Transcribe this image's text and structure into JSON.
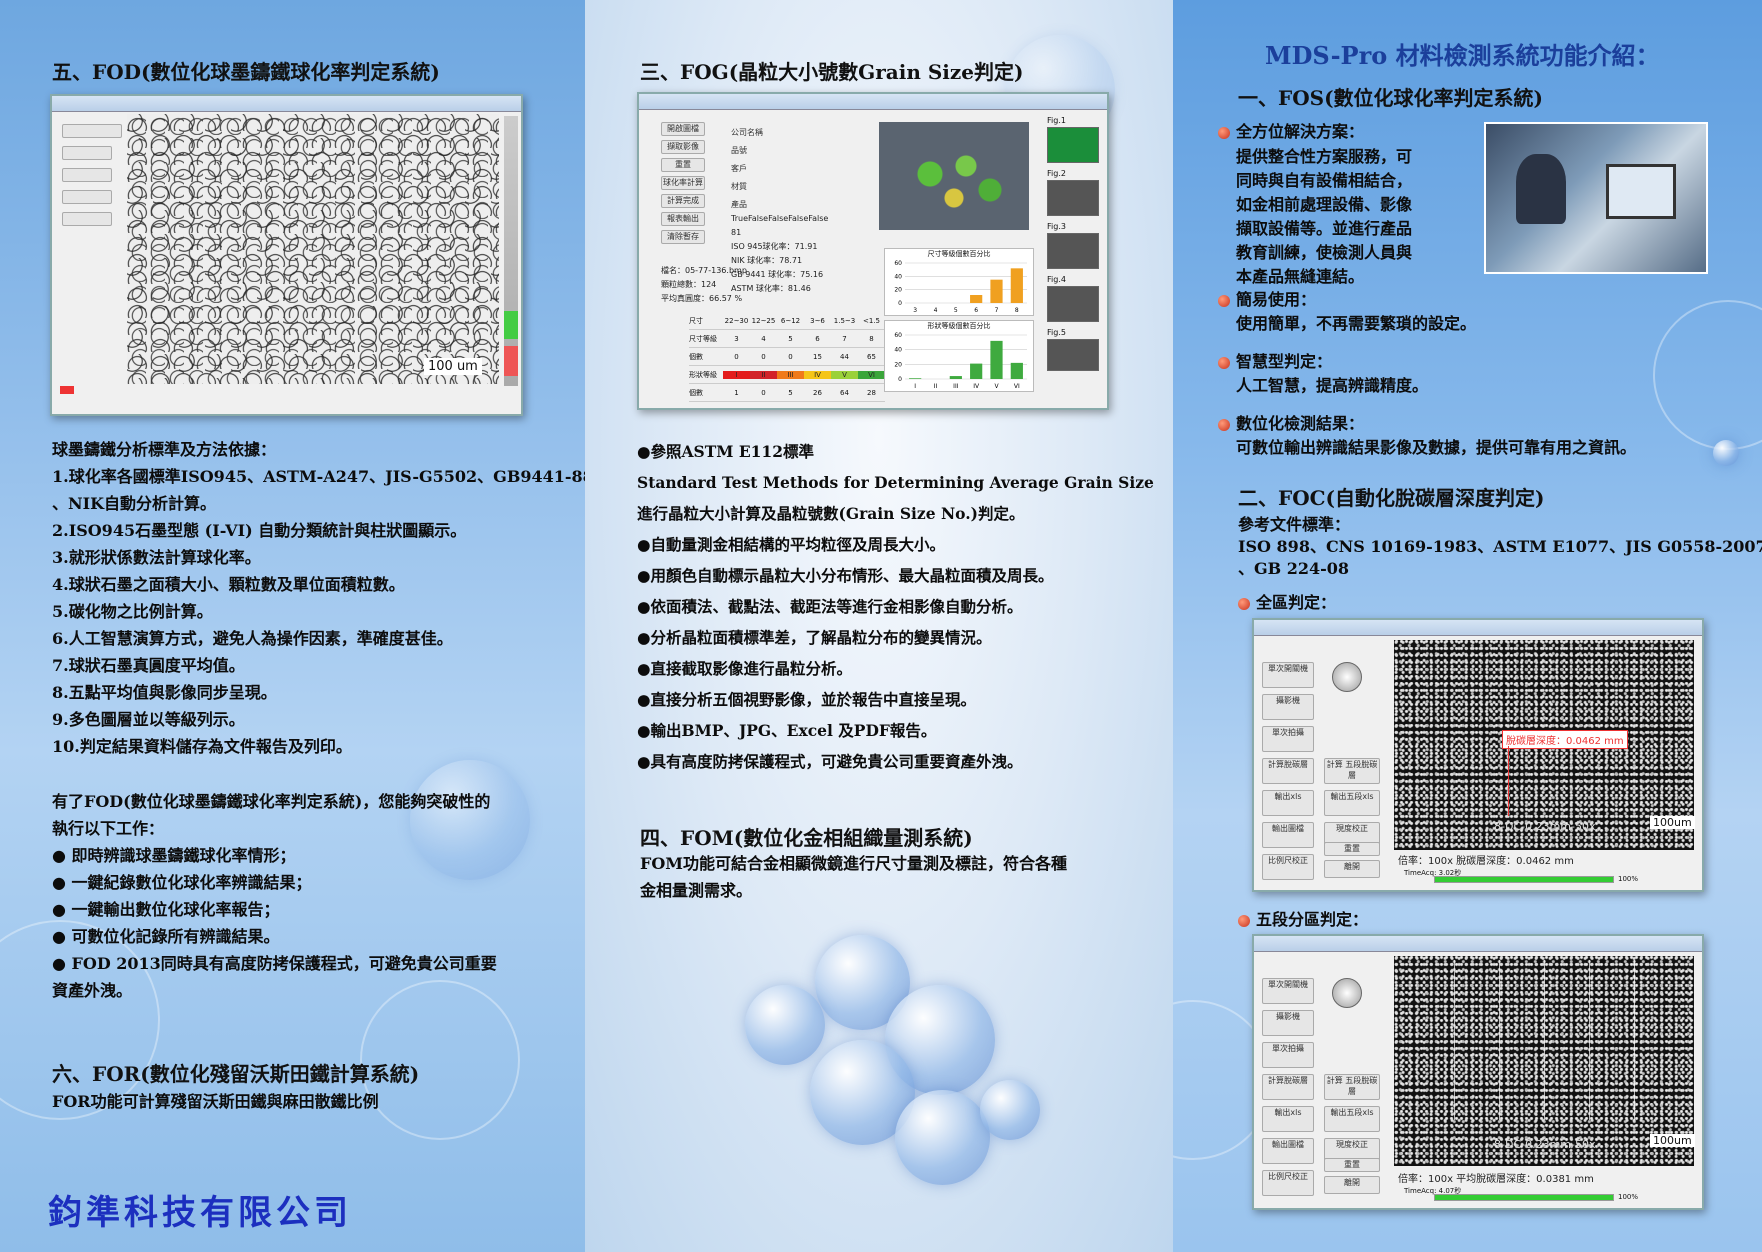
{
  "company": "鈞準科技有限公司",
  "main_title": "MDS-Pro 材料檢測系統功能介紹：",
  "fod": {
    "heading": "五、FOD(數位化球墨鑄鐵球化率判定系統)",
    "scale_label": "100 um",
    "basis_title": "球墨鑄鐵分析標準及方法依據：",
    "basis_items": [
      "1.球化率各國標準ISO945、ASTM-A247、JIS-G5502、GB9441-88",
      "   、NIK自動分析計算。",
      "2.ISO945石墨型態 (I-VI) 自動分類統計與柱狀圖顯示。",
      "3.就形狀係數法計算球化率。",
      "4.球狀石墨之面積大小、顆粒數及單位面積粒數。",
      "5.碳化物之比例計算。",
      "6.人工智慧演算方式，避免人為操作因素，準確度甚佳。",
      "7.球狀石墨真圓度平均值。",
      "8.五點平均值與影像同步呈現。",
      "9.多色圖層並以等級列示。",
      "10.判定結果資料儲存為文件報告及列印。"
    ],
    "work_title_1": "有了FOD(數位化球墨鑄鐵球化率判定系統)，您能夠突破性的",
    "work_title_2": "執行以下工作：",
    "work_items": [
      "●  即時辨識球墨鑄鐵球化率情形；",
      "●  一鍵紀錄數位化球化率辨識結果；",
      "●  一鍵輸出數位化球化率報告；",
      "●  可數位化記錄所有辨識結果。",
      "●  FOD 2013同時具有高度防拷保護程式，可避免貴公司重要",
      "     資產外洩。"
    ]
  },
  "for": {
    "heading": "六、FOR(數位化殘留沃斯田鐵計算系統)",
    "desc": "FOR功能可計算殘留沃斯田鐵與麻田散鐵比例"
  },
  "fog": {
    "heading": "三、FOG(晶粒大小號數Grain Size判定)",
    "screenshot": {
      "readouts": [
        "TrueFalseFalseFalseFalse",
        "81",
        "ISO 945球化率：71.91",
        "NIK 球化率：78.71",
        "GB 9441 球化率：75.16",
        "ASTM 球化率：81.46"
      ],
      "file_info": [
        "檔名：05-77-136.bmp",
        "顆粒總數：124",
        "平均真圓度：66.57 %"
      ],
      "chart1_title": "尺寸等級個數百分比",
      "chart2_title": "形狀等級個數百分比",
      "fig_labels": [
        "Fig.1",
        "Fig.2",
        "Fig.3",
        "Fig.4",
        "Fig.5"
      ],
      "buttons": [
        "開啟圖檔",
        "擷取影像",
        "重置",
        "球化率計算",
        "計算完成",
        "報表輸出",
        "清除暫存"
      ],
      "fields": [
        "公司名稱",
        "品號",
        "客戶",
        "材質",
        "產品"
      ],
      "table_rows": [
        {
          "label": "尺寸",
          "cells": [
            "22~30",
            "12~25",
            "6~12",
            "3~6",
            "1.5~3",
            "<1.5"
          ]
        },
        {
          "label": "尺寸等級",
          "cells": [
            "3",
            "4",
            "5",
            "6",
            "7",
            "8"
          ]
        },
        {
          "label": "個數",
          "cells": [
            "0",
            "0",
            "0",
            "15",
            "44",
            "65"
          ]
        },
        {
          "label": "形狀等級",
          "cells": [
            "I",
            "II",
            "III",
            "IV",
            "V",
            "VI"
          ]
        },
        {
          "label": "個數",
          "cells": [
            "1",
            "0",
            "5",
            "26",
            "64",
            "28"
          ]
        }
      ]
    },
    "chart_data": [
      {
        "type": "bar",
        "title": "尺寸等級個數百分比",
        "categories": [
          "3",
          "4",
          "5",
          "6",
          "7",
          "8"
        ],
        "values": [
          0,
          0,
          0,
          12,
          35,
          52
        ],
        "ylim": [
          0,
          60
        ]
      },
      {
        "type": "bar",
        "title": "形狀等級個數百分比",
        "categories": [
          "I",
          "II",
          "III",
          "IV",
          "V",
          "VI"
        ],
        "values": [
          1,
          0,
          4,
          21,
          52,
          22
        ],
        "ylim": [
          0,
          60
        ]
      }
    ],
    "points": [
      "●參照ASTM E112標準",
      "   Standard Test Methods for Determining Average Grain Size",
      "   進行晶粒大小計算及晶粒號數(Grain Size No.)判定。",
      "●自動量測金相結構的平均粒徑及周長大小。",
      "●用顏色自動標示晶粒大小分布情形、最大晶粒面積及周長。",
      "●依面積法、截點法、截距法等進行金相影像自動分析。",
      "●分析晶粒面積標準差，了解晶粒分布的變異情況。",
      "●直接截取影像進行晶粒分析。",
      "●直接分析五個視野影像，並於報告中直接呈現。",
      "●輸出BMP、JPG、Excel 及PDF報告。",
      "●具有高度防拷保護程式，可避免貴公司重要資產外洩。"
    ]
  },
  "fom": {
    "heading": "四、FOM(數位化金相組織量測系統)",
    "desc_1": "FOM功能可結合金相顯微鏡進行尺寸量測及標註，符合各種",
    "desc_2": "金相量測需求。"
  },
  "fos": {
    "heading": "一、FOS(數位化球化率判定系統)",
    "features": [
      {
        "title": "全方位解決方案：",
        "lines": [
          "提供整合性方案服務，可",
          "同時與自有設備相結合，",
          "如金相前處理設備、影像",
          "擷取設備等。並進行產品",
          "教育訓練，使檢測人員與",
          "本產品無縫連結。"
        ]
      },
      {
        "title": "簡易使用：",
        "lines": [
          "使用簡單，不再需要繁瑣的設定。"
        ]
      },
      {
        "title": "智慧型判定：",
        "lines": [
          "人工智慧，提高辨識精度。"
        ]
      },
      {
        "title": "數位化檢測結果：",
        "lines": [
          "可數位輸出辨識結果影像及數據，提供可靠有用之資訊。"
        ]
      }
    ]
  },
  "foc": {
    "heading": "二、FOC(自動化脫碳層深度判定)",
    "ref_title": "參考文件標準：",
    "ref_line_1": "ISO 898、CNS 10169-1983、ASTM E1077、JIS G0558-2007",
    "ref_line_2": "、GB 224-08",
    "full_title": "全區判定：",
    "five_title": "五段分區判定：",
    "shot1": {
      "depth_label": "脫碳層深度：0.0462 mm",
      "bottom_text": "倍率：100x   脫碳層深度：0.0462 mm",
      "scale": "100um",
      "sample": "8-DC-0.23mm-50x",
      "time_label": "TimeAcq: 3.02秒",
      "progress_pct": "100%"
    },
    "shot2": {
      "bottom_text": "倍率：100x   平均脫碳層深度：0.0381 mm",
      "scale": "100um",
      "sample": "8-DC-0.23mm-50x",
      "time_label": "TimeAcq: 4.07秒",
      "progress_pct": "100%"
    },
    "buttons": [
      "單次開關機",
      "攝影機",
      "單次拍攝",
      "計算脫碳層",
      "輸出xls",
      "輸出圖檔",
      "比例尺校正"
    ],
    "buttons_right": [
      "計算 五段脫碳層",
      "輸出五段xls",
      "現度校正",
      "重置",
      "離開"
    ]
  }
}
